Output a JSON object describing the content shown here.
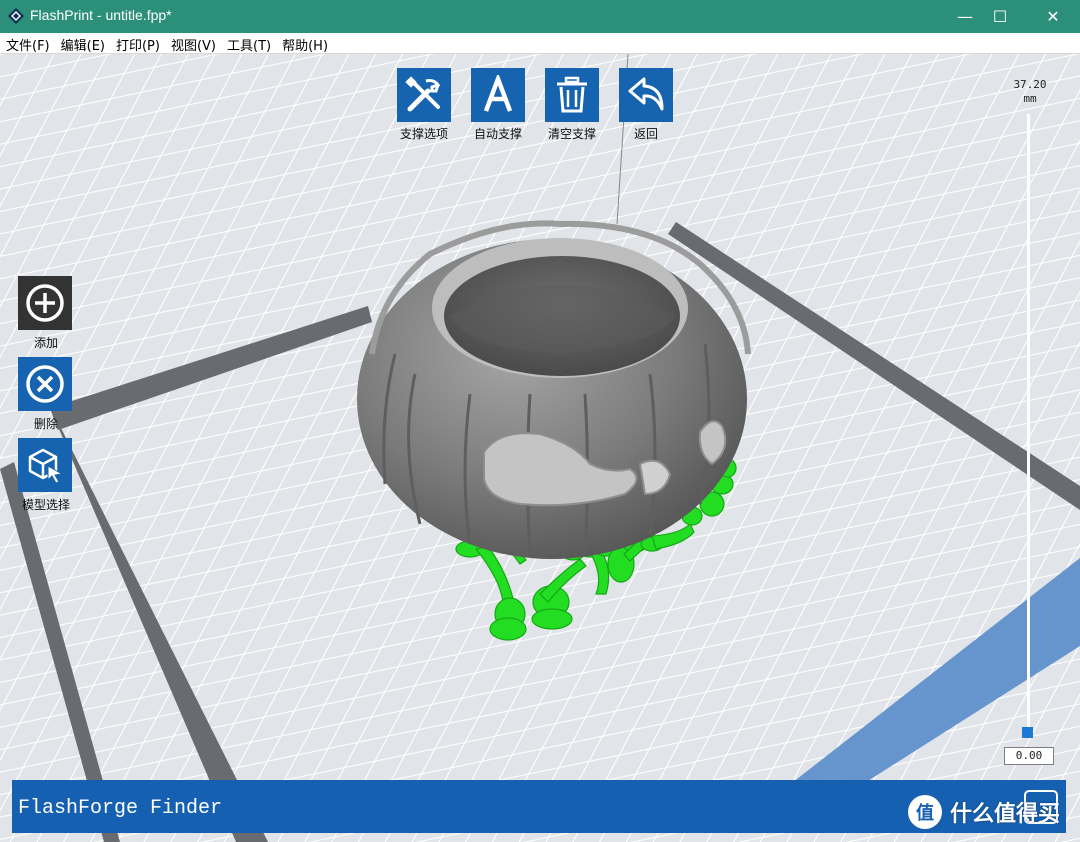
{
  "window": {
    "title": "FlashPrint - untitle.fpp*",
    "controls": {
      "minimize": "—",
      "maximize": "☐",
      "close": "✕"
    }
  },
  "menu": [
    {
      "label": "文件(F)"
    },
    {
      "label": "编辑(E)"
    },
    {
      "label": "打印(P)"
    },
    {
      "label": "视图(V)"
    },
    {
      "label": "工具(T)"
    },
    {
      "label": "帮助(H)"
    }
  ],
  "top_toolbar": [
    {
      "label": "支撑选项",
      "icon": "tools-icon"
    },
    {
      "label": "自动支撑",
      "icon": "letter-a-icon"
    },
    {
      "label": "清空支撑",
      "icon": "trash-icon"
    },
    {
      "label": "返回",
      "icon": "undo-arrow-icon"
    }
  ],
  "left_toolbar": [
    {
      "label": "添加",
      "icon": "plus-circle-icon"
    },
    {
      "label": "删除",
      "icon": "x-circle-icon"
    },
    {
      "label": "模型选择",
      "icon": "cube-cursor-icon"
    }
  ],
  "height_slider": {
    "max_value": "37.20",
    "unit": "mm",
    "current_value": "0.00",
    "level": 0
  },
  "status_bar": {
    "printer_name": "FlashForge Finder"
  },
  "watermark": {
    "text": "什么值得买",
    "logo": "值"
  },
  "colors": {
    "titlebar": "#2b8f79",
    "accent": "#1663b0",
    "active_tool": "#333333",
    "model": "#808080",
    "supports": "#22dd22",
    "platform": "#e1e4e8",
    "grid_border": "#686b70",
    "highlight_strip": "#5b8ecb"
  }
}
